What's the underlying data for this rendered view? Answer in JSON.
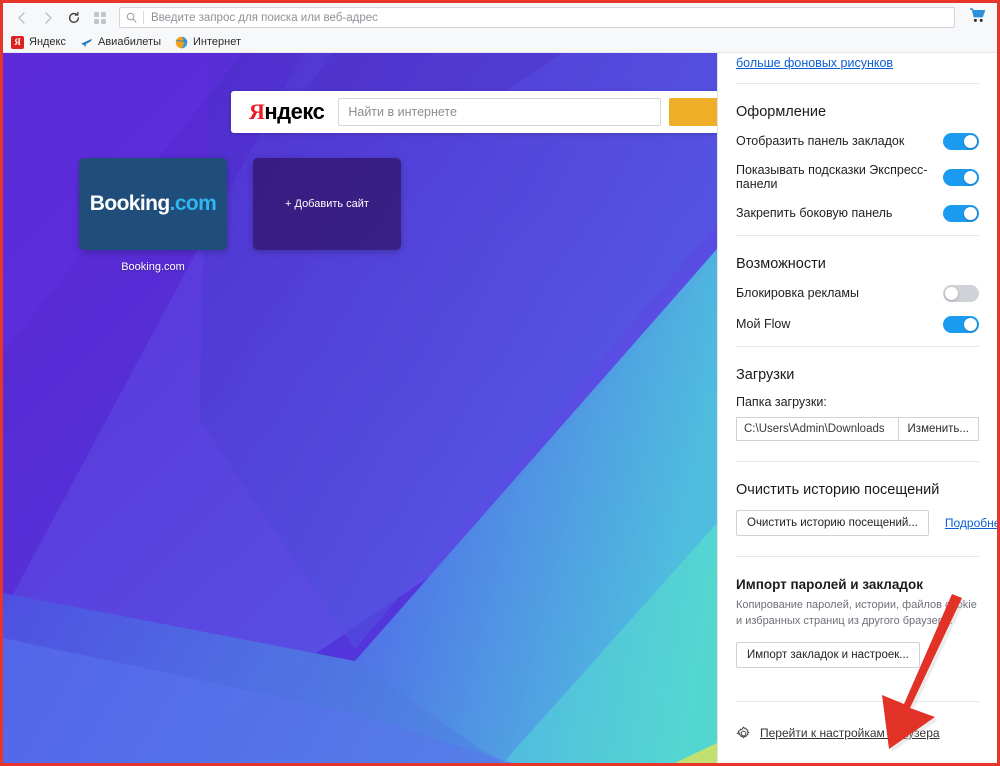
{
  "browser": {
    "nav": {
      "back_icon": "chevron-left-icon",
      "forward_icon": "chevron-right-icon",
      "reload_icon": "reload-icon",
      "tabs_overview_icon": "grid-squares-icon"
    },
    "address_bar": {
      "search_icon": "search-icon",
      "placeholder": "Введите запрос для поиска или веб-адрес",
      "value": ""
    },
    "cart_icon": "shopping-cart-icon",
    "bookmarks": [
      {
        "label": "Яндекс",
        "icon": "yandex-favicon",
        "glyph": "Я"
      },
      {
        "label": "Авиабилеты",
        "icon": "airplane-favicon",
        "glyph": "✈"
      },
      {
        "label": "Интернет",
        "icon": "globe-favicon",
        "glyph": "🌐"
      }
    ]
  },
  "newtab": {
    "search": {
      "logo_prefix": "Я",
      "logo_rest": "ндекс",
      "placeholder": "Найти в интернете",
      "go_button_label": ""
    },
    "tiles": [
      {
        "name": "booking",
        "logo_main": "Booking",
        "logo_suffix": ".com",
        "caption": "Booking.com"
      },
      {
        "name": "add-site",
        "label": "+ Добавить сайт",
        "caption": ""
      }
    ]
  },
  "panel": {
    "top_link": "больше фоновых рисунков",
    "sections": {
      "appearance": {
        "title": "Оформление",
        "rows": [
          {
            "label": "Отобразить панель закладок",
            "on": true
          },
          {
            "label": "Показывать подсказки Экспресс-панели",
            "on": true
          },
          {
            "label": "Закрепить боковую панель",
            "on": true
          }
        ]
      },
      "features": {
        "title": "Возможности",
        "rows": [
          {
            "label": "Блокировка рекламы",
            "on": false
          },
          {
            "label": "Мой Flow",
            "on": true
          }
        ]
      },
      "downloads": {
        "title": "Загрузки",
        "folder_label": "Папка загрузки:",
        "folder_path": "C:\\Users\\Admin\\Downloads",
        "change_button": "Изменить..."
      },
      "history": {
        "title": "Очистить историю посещений",
        "clear_button": "Очистить историю посещений...",
        "more_link": "Подробнее"
      },
      "import": {
        "title": "Импорт паролей и закладок",
        "description": "Копирование паролей, истории, файлов cookie и избранных страниц из другого браузера.",
        "import_button": "Импорт закладок и настроек..."
      }
    },
    "footer": {
      "gear_icon": "gear-icon",
      "link": "Перейти к настройкам браузера"
    }
  },
  "annotation": {
    "frame_color": "#e8352b",
    "arrow_color": "#e23127",
    "arrow_icon": "arrow-pointing-down-left-icon"
  },
  "colors": {
    "accent_toggle_on": "#1a9bf0",
    "toggle_off": "#cfd2d7",
    "link": "#0b5fd6",
    "yandex_red": "#ec1c24",
    "search_button": "#eeae28",
    "newtab_purple": "#5b2fd6",
    "booking_tile": "#1f4e7a",
    "booking_dotcom": "#2fb5f0"
  }
}
